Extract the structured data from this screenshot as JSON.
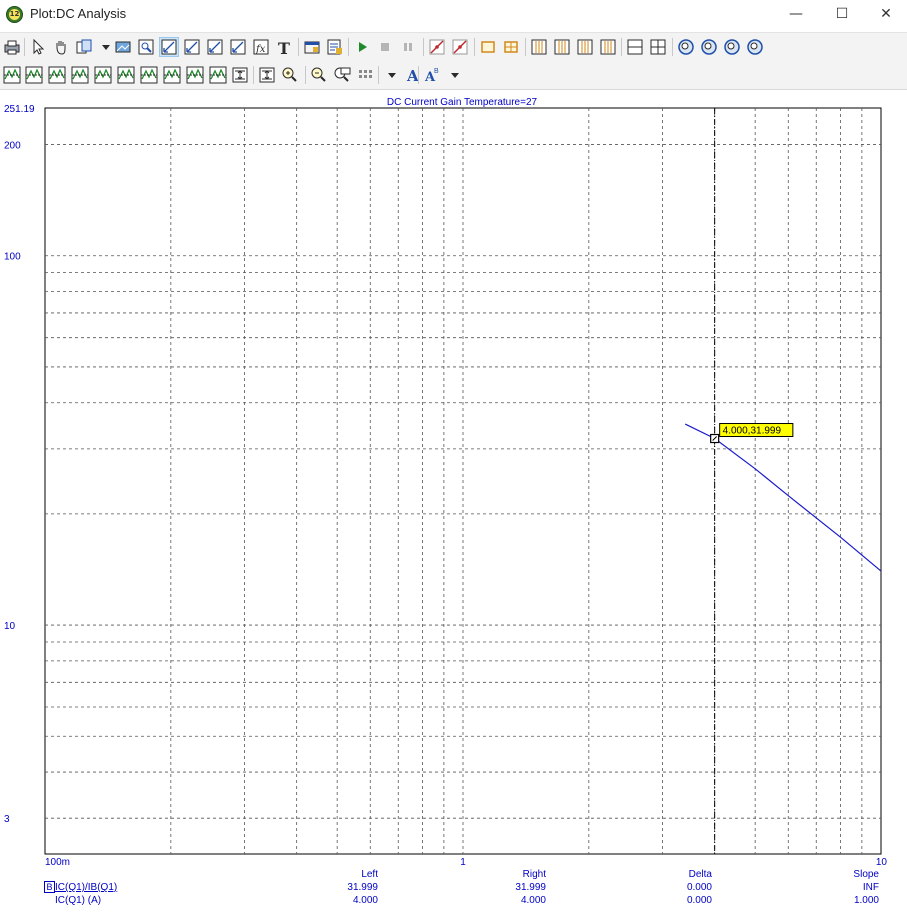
{
  "window": {
    "title": "Plot:DC Analysis",
    "app_badge": "12",
    "minimize": "—",
    "maximize": "☐",
    "close": "✕"
  },
  "toolbar_row1": [
    "printer-icon",
    "select-arrow-icon",
    "pan-hand-icon",
    "copy-icon",
    "dropdown-icon",
    "image-icon",
    "zoom-image-icon",
    "scale-x-icon",
    "scale-y-icon",
    "scale-xy-icon",
    "scale-auto-icon",
    "function-icon",
    "text-tool-icon",
    "properties-icon",
    "data-properties-icon",
    "run-icon",
    "stop-icon",
    "pause-icon",
    "tangent-icon",
    "slope-icon",
    "box-icon",
    "grid-box-icon",
    "split-1-icon",
    "split-2-icon",
    "split-3-icon",
    "split-4-icon",
    "horizontal-split-icon",
    "grid-split-icon",
    "zoom-fit-icon",
    "zoom-in-fit-icon",
    "zoom-function-icon",
    "zoom-reset-icon"
  ],
  "toolbar_row2": [
    "peak-icon",
    "valley-icon",
    "high-icon",
    "low-icon",
    "inflection-icon",
    "global-high-icon",
    "global-low-icon",
    "top-icon",
    "bottom-icon",
    "next-cursor-icon",
    "auto-scale-icon",
    "fit-scale-icon",
    "zoom-in-icon",
    "zoom-out-icon",
    "zoom-100-icon",
    "layout-grid-icon",
    "layout-dropdown-icon",
    "font-icon",
    "tag-font-icon",
    "tag-dropdown-icon"
  ],
  "chart_data": {
    "type": "line",
    "title": "DC Current Gain Temperature=27",
    "x_scale": "log",
    "y_scale": "log",
    "xlim": [
      0.1,
      10
    ],
    "ylim": [
      2.4,
      251.19
    ],
    "x_tick_labels": [
      {
        "value": 0.1,
        "label": "100m"
      },
      {
        "value": 1,
        "label": "1"
      },
      {
        "value": 10,
        "label": "10"
      }
    ],
    "y_tick_labels": [
      {
        "value": 251.19,
        "label": "251.19"
      },
      {
        "value": 200,
        "label": "200"
      },
      {
        "value": 100,
        "label": "100"
      },
      {
        "value": 10,
        "label": "10"
      },
      {
        "value": 3,
        "label": "3"
      }
    ],
    "grid": true,
    "series": [
      {
        "name": "IC(Q1)/IB(Q1)",
        "color": "#1a1acc",
        "x": [
          3.4,
          4.0,
          5.0,
          6.0,
          8.0,
          10.0
        ],
        "y": [
          35.0,
          31.999,
          26.5,
          22.4,
          17.3,
          14.0
        ]
      }
    ],
    "cursor": {
      "x": 4.0,
      "y": 31.999,
      "label": "4.000,31.999"
    }
  },
  "legend": {
    "headers": {
      "left": "Left",
      "right": "Right",
      "delta": "Delta",
      "slope": "Slope"
    },
    "rows": [
      {
        "marker": "B",
        "name": "IC(Q1)/IB(Q1)",
        "left": "31.999",
        "right": "31.999",
        "delta": "0.000",
        "slope": "INF"
      },
      {
        "marker": "",
        "name": "IC(Q1) (A)",
        "left": "4.000",
        "right": "4.000",
        "delta": "0.000",
        "slope": "1.000"
      }
    ]
  }
}
